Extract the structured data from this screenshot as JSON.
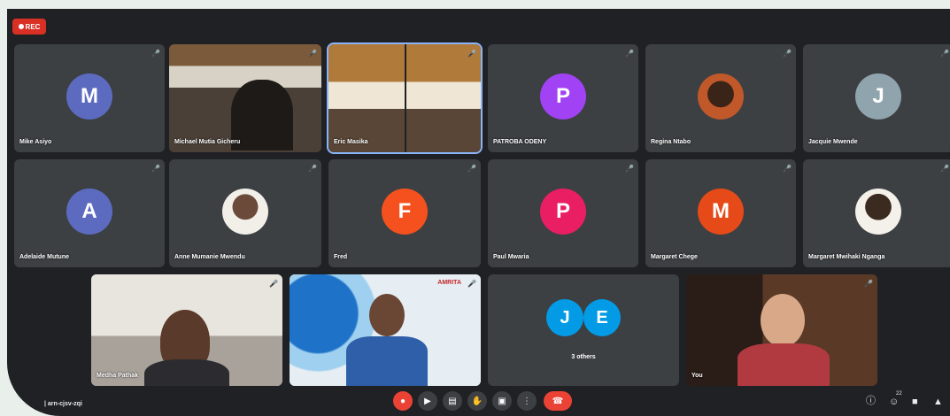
{
  "recording": {
    "label": "REC"
  },
  "participants": [
    {
      "name": "Mike Asiyo",
      "initial": "M",
      "color": "#5c6bc0"
    },
    {
      "name": "Michael Mutia Gicheru",
      "initial": "",
      "color": ""
    },
    {
      "name": "Eric Masika",
      "initial": "",
      "color": ""
    },
    {
      "name": "PATROBA ODENY",
      "initial": "P",
      "color": "#a142f4"
    },
    {
      "name": "Regina Ntabo",
      "initial": "",
      "color": ""
    },
    {
      "name": "Jacquie Mwende",
      "initial": "J",
      "color": "#90a4ae"
    },
    {
      "name": "Adelaide Mutune",
      "initial": "A",
      "color": "#5c6bc0"
    },
    {
      "name": "Anne Mumanie Mwendu",
      "initial": "",
      "color": ""
    },
    {
      "name": "Fred",
      "initial": "F",
      "color": "#f4511e"
    },
    {
      "name": "Paul Mwaria",
      "initial": "P",
      "color": "#e91e63"
    },
    {
      "name": "Margaret Chege",
      "initial": "M",
      "color": "#e64a19"
    },
    {
      "name": "Margaret Mwihaki Nganga",
      "initial": "",
      "color": ""
    },
    {
      "name": "Medha Pathak",
      "initial": "",
      "color": ""
    },
    {
      "name": "",
      "initial": "",
      "color": ""
    },
    {
      "name": "You",
      "initial": "",
      "color": ""
    }
  ],
  "others": {
    "initials": [
      "J",
      "E"
    ],
    "color": "#039be5",
    "label": "3 others"
  },
  "banner_text": "AMRITA",
  "meeting": {
    "code": "arn-cjsv-zqi"
  },
  "controls": [
    "mic-off",
    "captions",
    "present",
    "raise-hand",
    "more-present",
    "more-options",
    "hang-up"
  ],
  "right_icons": [
    "info",
    "people",
    "chat",
    "activities"
  ],
  "people_badge": "22"
}
